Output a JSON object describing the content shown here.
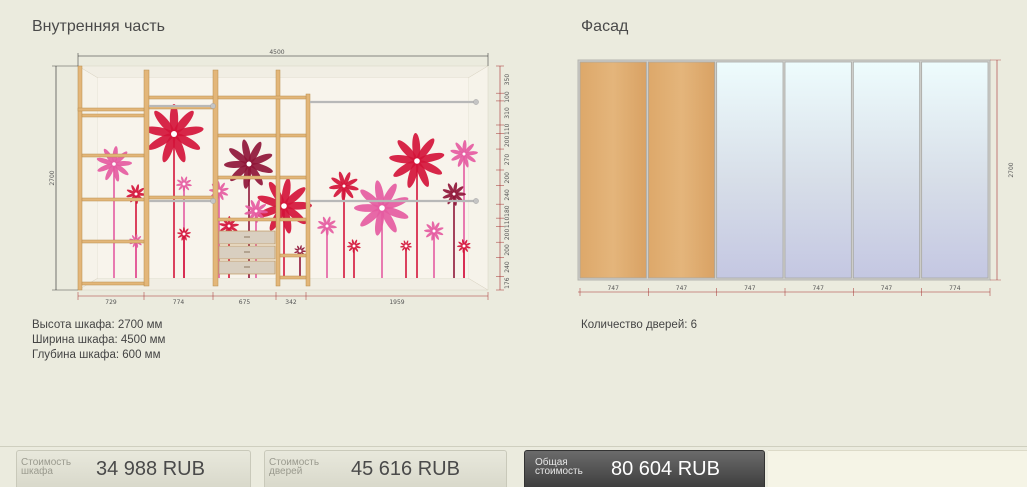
{
  "interior": {
    "title": "Внутренняя часть",
    "width_dim": "4500",
    "height_dim": "2700",
    "bottom_dims": [
      "729",
      "774",
      "675",
      "342",
      "1959"
    ],
    "right_dims": [
      "350",
      "100",
      "310",
      "110",
      "200",
      "270",
      "200",
      "240",
      "180",
      "110",
      "200",
      "200",
      "240",
      "176"
    ],
    "specs": {
      "height": "Высота шкафа: 2700 мм",
      "width": "Ширина шкафа: 4500 мм",
      "depth": "Глубина шкафа: 600 мм"
    }
  },
  "facade": {
    "title": "Фасад",
    "height_dim": "2700",
    "door_dims": [
      "747",
      "747",
      "747",
      "747",
      "747",
      "774"
    ],
    "doors": [
      {
        "type": "wood"
      },
      {
        "type": "wood"
      },
      {
        "type": "mirror"
      },
      {
        "type": "mirror"
      },
      {
        "type": "mirror"
      },
      {
        "type": "mirror"
      }
    ],
    "doors_count": "Количество дверей: 6"
  },
  "prices": {
    "wardrobe": {
      "label": "Стоимость шкафа",
      "value": "34 988  RUB"
    },
    "doors": {
      "label": "Стоимость дверей",
      "value": "45 616  RUB"
    },
    "total": {
      "label": "Общая стоимость",
      "value": "80 604  RUB"
    }
  },
  "colors": {
    "background": "#ebebde",
    "wood": "#e3b679",
    "wood_edge": "#b98d4f",
    "dimension_line": "#a53030",
    "flower_red": "#d4143a",
    "flower_pink": "#e55ba1",
    "flower_dark": "#8f1538",
    "mirror_top": "#eefcfd",
    "mirror_bottom": "#c9cde6"
  }
}
